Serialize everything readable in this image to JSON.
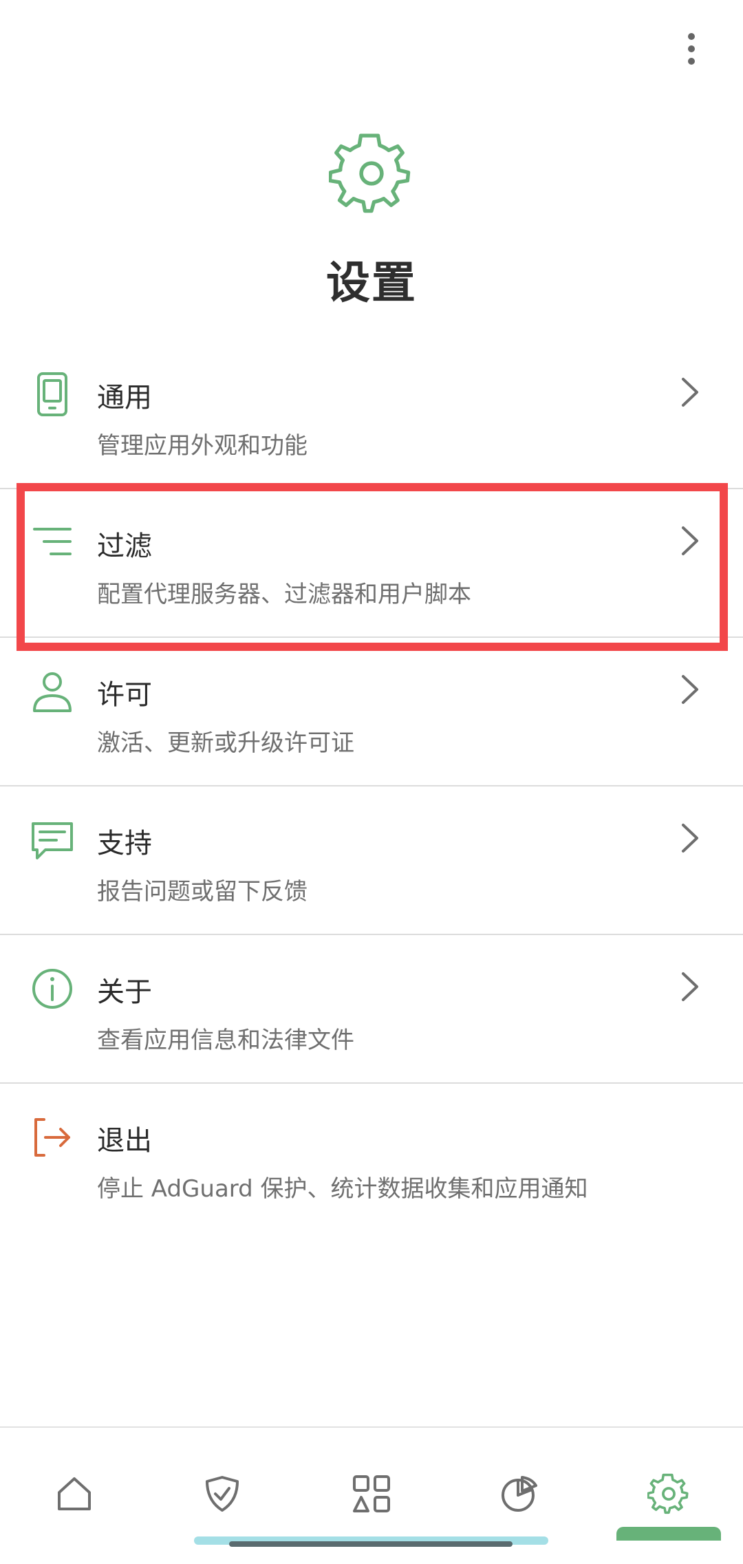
{
  "header": {
    "title": "设置",
    "icon": "gear-icon",
    "menu_icon": "more-vertical-icon"
  },
  "settings": [
    {
      "id": "general",
      "title": "通用",
      "subtitle": "管理应用外观和功能",
      "icon": "phone-icon"
    },
    {
      "id": "filtering",
      "title": "过滤",
      "subtitle": "配置代理服务器、过滤器和用户脚本",
      "icon": "filter-lines-icon"
    },
    {
      "id": "license",
      "title": "许可",
      "subtitle": "激活、更新或升级许可证",
      "icon": "user-icon"
    },
    {
      "id": "support",
      "title": "支持",
      "subtitle": "报告问题或留下反馈",
      "icon": "chat-icon"
    },
    {
      "id": "about",
      "title": "关于",
      "subtitle": "查看应用信息和法律文件",
      "icon": "info-icon"
    },
    {
      "id": "exit",
      "title": "退出",
      "subtitle": "停止 AdGuard 保护、统计数据收集和应用通知",
      "icon": "exit-icon"
    }
  ],
  "bottom_nav": [
    {
      "id": "home",
      "icon": "home-icon",
      "active": false
    },
    {
      "id": "protection",
      "icon": "shield-check-icon",
      "active": false
    },
    {
      "id": "apps",
      "icon": "apps-shapes-icon",
      "active": false
    },
    {
      "id": "statistics",
      "icon": "pie-chart-icon",
      "active": false
    },
    {
      "id": "settings",
      "icon": "gear-icon",
      "active": true
    }
  ],
  "colors": {
    "accent": "#67b279",
    "exit_icon": "#d86a3c",
    "highlight": "#f2474a",
    "nav_icon": "#6e6e6e"
  }
}
